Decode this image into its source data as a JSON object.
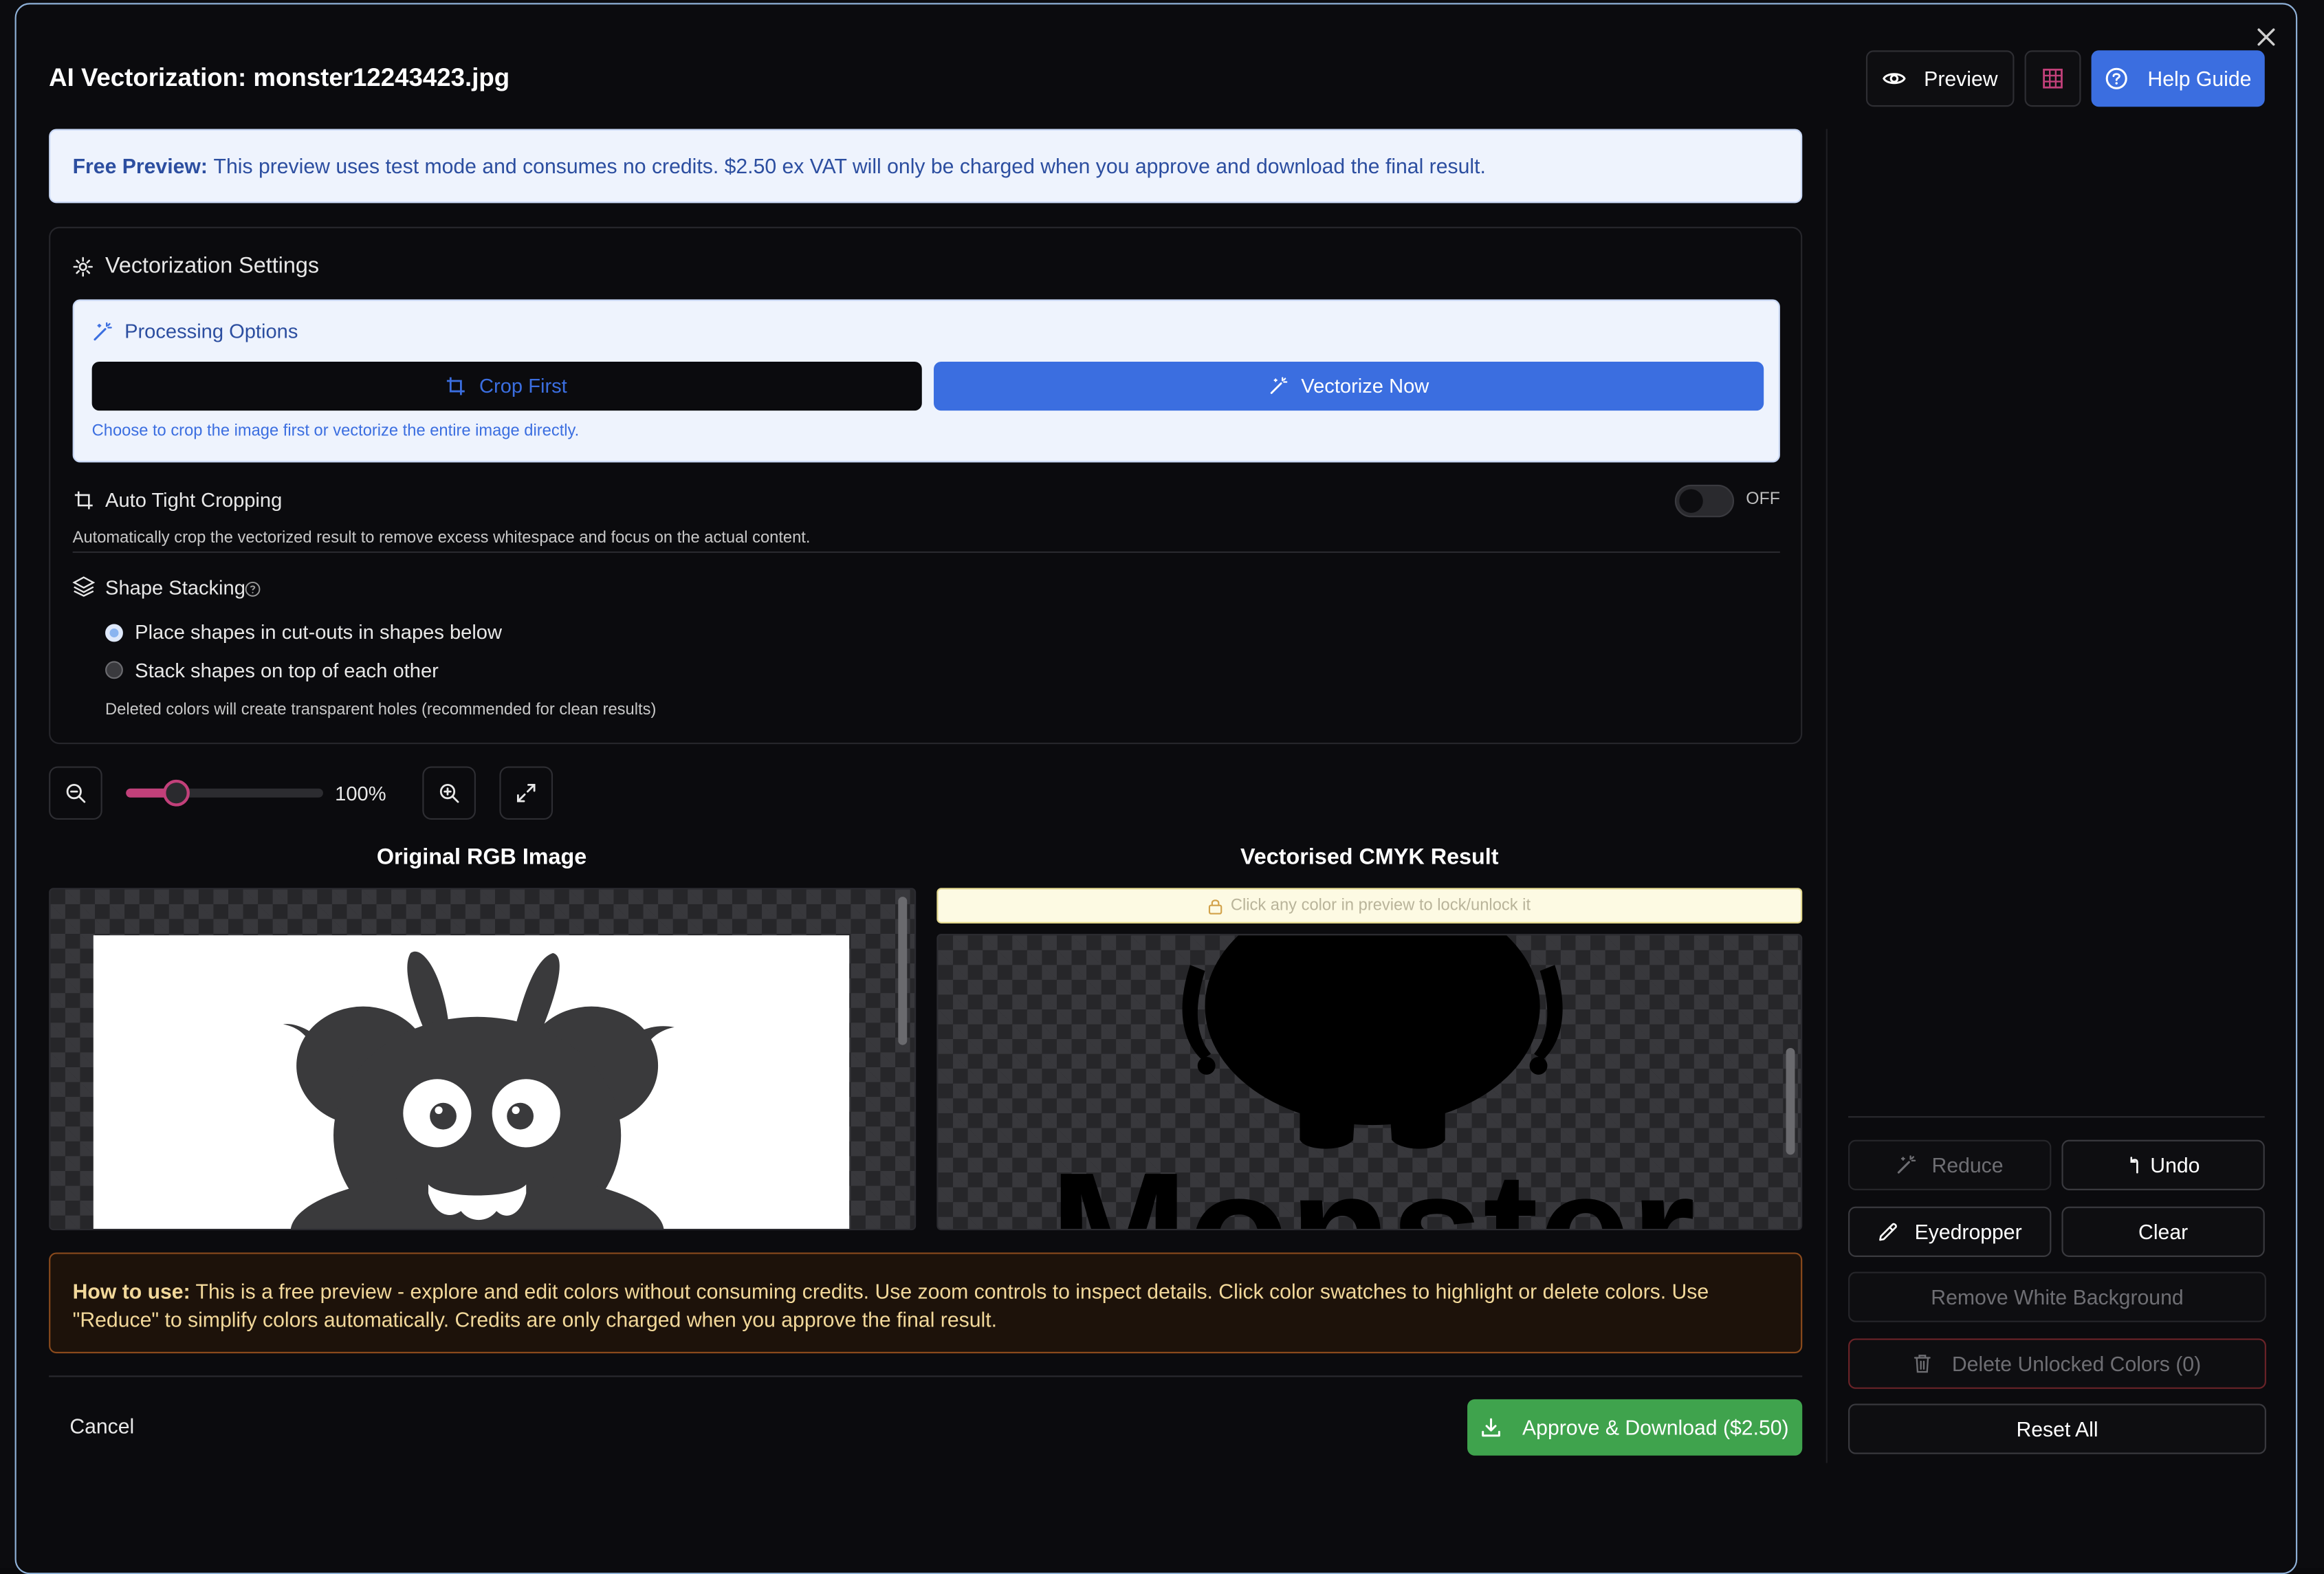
{
  "dialog": {
    "title": "AI Vectorization: monster12243423.jpg",
    "preview_label": "Preview",
    "help_label": "Help Guide"
  },
  "banner": {
    "bold": "Free Preview:",
    "text": "This preview uses test mode and consumes no credits. $2.50 ex VAT will only be charged when you approve and download the final result."
  },
  "settings": {
    "heading": "Vectorization Settings",
    "processing": {
      "title": "Processing Options",
      "crop_label": "Crop First",
      "vectorize_label": "Vectorize Now",
      "hint": "Choose to crop the image first or vectorize the entire image directly."
    },
    "auto_crop": {
      "label": "Auto Tight Cropping",
      "state": "OFF",
      "description": "Automatically crop the vectorized result to remove excess whitespace and focus on the actual content."
    },
    "stacking": {
      "label": "Shape Stacking",
      "options": [
        "Place shapes in cut-outs in shapes below",
        "Stack shapes on top of each other"
      ],
      "selected_index": 0,
      "note": "Deleted colors will create transparent holes (recommended for clean results)"
    }
  },
  "zoom": {
    "value": 100,
    "label": "100%"
  },
  "original": {
    "heading": "Original RGB Image"
  },
  "result": {
    "heading": "Vectorised CMYK Result",
    "lock_hint": "Click any color in preview to lock/unlock it",
    "text_art": "Monster"
  },
  "howto": {
    "bold": "How to use:",
    "text": "This is a free preview - explore and edit colors without consuming credits. Use zoom controls to inspect details. Click color swatches to highlight or delete colors. Use \"Reduce\" to simplify colors automatically. Credits are only charged when you approve the final result."
  },
  "footer": {
    "cancel_label": "Cancel",
    "approve_label": "Approve & Download ($2.50)"
  },
  "sidebar": {
    "reduce_label": "Reduce",
    "undo_label": "Undo",
    "eyedropper_label": "Eyedropper",
    "clear_label": "Clear",
    "remove_white_label": "Remove White Background",
    "delete_unlocked_label": "Delete Unlocked Colors (0)",
    "reset_label": "Reset All"
  },
  "colors": {
    "accent_blue": "#3b6ee0",
    "approve_green": "#3fa34d",
    "slider_pink": "#c2407a",
    "monster_grey": "#3a3a3c"
  }
}
